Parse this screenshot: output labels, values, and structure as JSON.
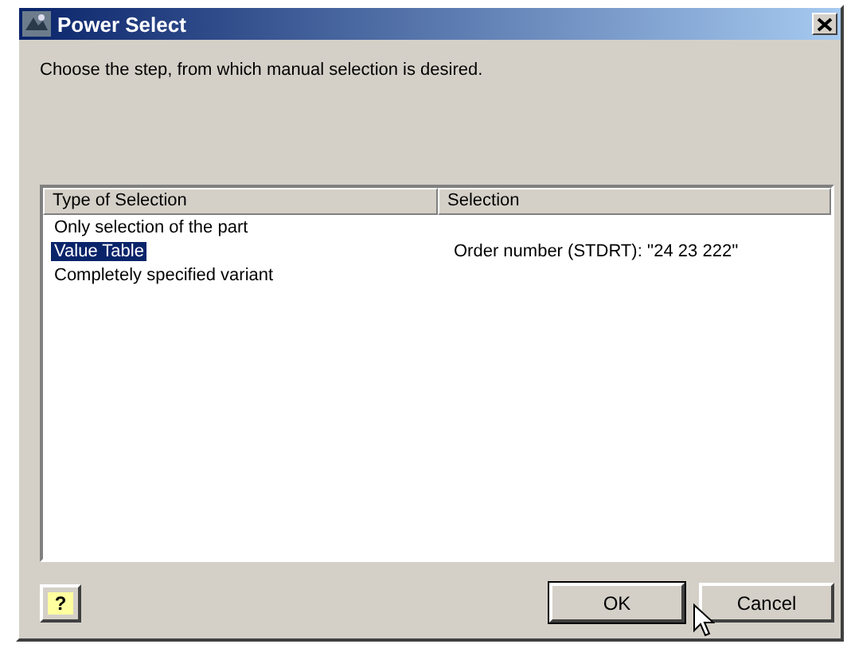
{
  "window": {
    "title": "Power Select"
  },
  "instruction": "Choose the step, from which manual selection is desired.",
  "table": {
    "columns": [
      "Type of Selection",
      "Selection"
    ],
    "rows": [
      {
        "cells": [
          "Only selection of the part",
          ""
        ],
        "selected": false
      },
      {
        "cells": [
          "Value Table",
          "Order number (STDRT): ''24 23 222''"
        ],
        "selected": true
      },
      {
        "cells": [
          "Completely specified variant",
          ""
        ],
        "selected": false
      }
    ]
  },
  "help_button": {
    "label": "?"
  },
  "buttons": [
    {
      "label": "OK",
      "default": true
    },
    {
      "label": "Cancel",
      "default": false
    }
  ]
}
